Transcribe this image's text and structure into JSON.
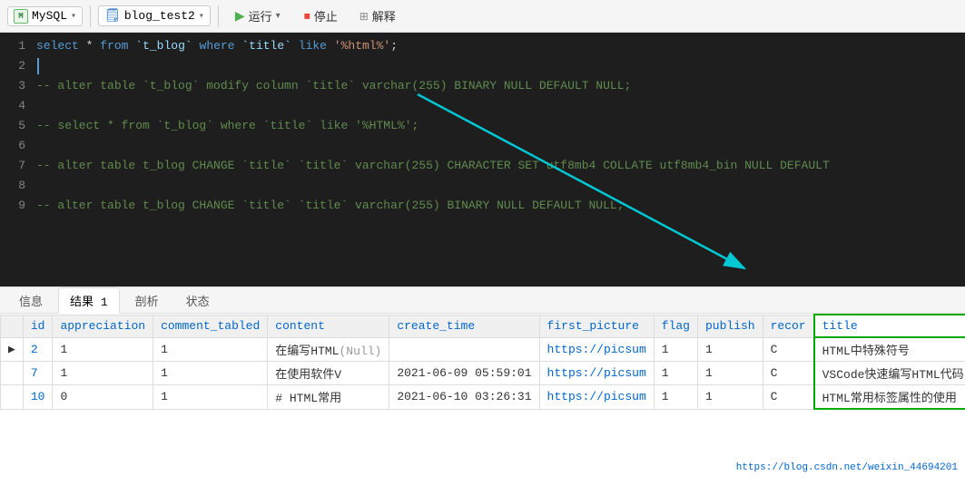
{
  "toolbar": {
    "db_icon": "M",
    "db_name": "MySQL",
    "table_name": "blog_test2",
    "run_label": "运行",
    "stop_label": "停止",
    "explain_label": "解释"
  },
  "editor": {
    "lines": [
      {
        "num": 1,
        "type": "sql",
        "content": "select * from `t_blog` where `title` like '%html%';"
      },
      {
        "num": 2,
        "type": "empty",
        "content": ""
      },
      {
        "num": 3,
        "type": "comment",
        "content": "-- alter table `t_blog` modify column `title` varchar(255) BINARY NULL DEFAULT NULL;"
      },
      {
        "num": 4,
        "type": "empty",
        "content": ""
      },
      {
        "num": 5,
        "type": "comment",
        "content": "-- select * from `t_blog` where `title` like '%HTML%';"
      },
      {
        "num": 6,
        "type": "empty",
        "content": ""
      },
      {
        "num": 7,
        "type": "comment",
        "content": "-- alter table t_blog CHANGE `title` `title` varchar(255) CHARACTER SET utf8mb4 COLLATE utf8mb4_bin NULL DEFAULT"
      },
      {
        "num": 8,
        "type": "empty",
        "content": ""
      },
      {
        "num": 9,
        "type": "comment",
        "content": "-- alter table t_blog CHANGE `title` `title` varchar(255) BINARY NULL DEFAULT NULL;"
      }
    ]
  },
  "tabs": [
    {
      "label": "信息",
      "active": false
    },
    {
      "label": "结果 1",
      "active": true
    },
    {
      "label": "剖析",
      "active": false
    },
    {
      "label": "状态",
      "active": false
    }
  ],
  "table": {
    "headers": [
      "id",
      "appreciation",
      "comment_tabled",
      "content",
      "create_time",
      "first_picture",
      "flag",
      "publish",
      "recor",
      "title"
    ],
    "rows": [
      {
        "arrow": "▶",
        "id": "2",
        "appreciation": "1",
        "comment_tabled": "1",
        "content": "在编写HTML",
        "content_null": "(Null)",
        "create_time": "",
        "first_picture": "https://picsum",
        "flag": "1",
        "publish": "1",
        "recor": "C",
        "title": "HTML中特殊符号"
      },
      {
        "arrow": "",
        "id": "7",
        "appreciation": "1",
        "comment_tabled": "1",
        "content": "在使用软件V",
        "content_null": "",
        "create_time": "2021-06-09 05:59:01",
        "first_picture": "https://picsum",
        "flag": "1",
        "publish": "1",
        "recor": "C",
        "title": "VSCode快速编写HTML代码"
      },
      {
        "arrow": "",
        "id": "10",
        "appreciation": "0",
        "comment_tabled": "1",
        "content": "# HTML常用",
        "content_null": "",
        "create_time": "2021-06-10 03:26:31",
        "first_picture": "https://picsum",
        "flag": "1",
        "publish": "1",
        "recor": "C",
        "title": "HTML常用标签属性的使用"
      }
    ]
  },
  "status_url": "https://blog.csdn.net/weixin_44694201"
}
